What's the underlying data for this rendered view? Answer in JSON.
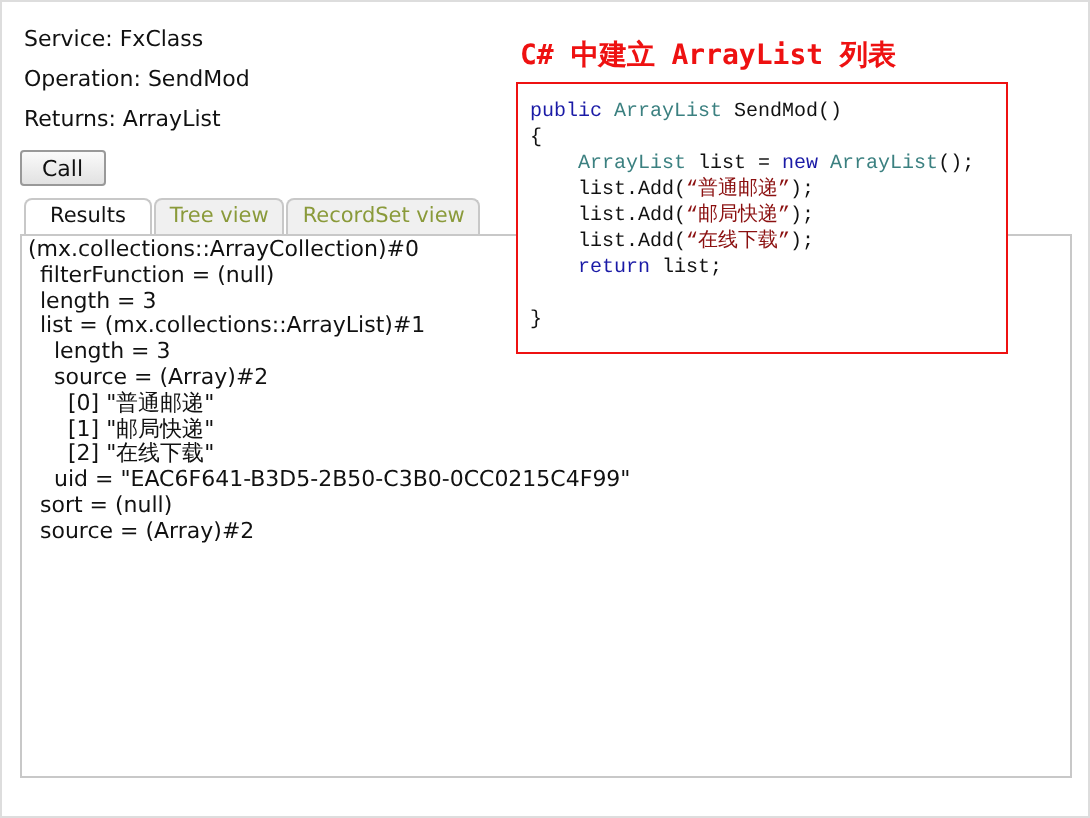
{
  "info": [
    {
      "label": "Service: FxClass"
    },
    {
      "label": "Operation: SendMod"
    },
    {
      "label": "Returns: ArrayList"
    }
  ],
  "call_button": {
    "label": "Call"
  },
  "tabs": [
    {
      "label": "Results",
      "selected": true
    },
    {
      "label": "Tree view",
      "selected": false
    },
    {
      "label": "RecordSet view",
      "selected": false
    }
  ],
  "results": [
    {
      "text": "(mx.collections::ArrayCollection)#0",
      "children": [
        {
          "text": "filterFunction = (null)"
        },
        {
          "text": "length = 3"
        },
        {
          "text": "list = (mx.collections::ArrayList)#1",
          "children": [
            {
              "text": "length = 3"
            },
            {
              "text": "source = (Array)#2",
              "children": [
                {
                  "text": "[0] \"普通邮递\""
                },
                {
                  "text": "[1] \"邮局快递\""
                },
                {
                  "text": "[2] \"在线下载\""
                }
              ]
            },
            {
              "text": "uid = \"EAC6F641-B3D5-2B50-C3B0-0CC0215C4F99\""
            }
          ]
        },
        {
          "text": "sort = (null)"
        },
        {
          "text": "source = (Array)#2"
        }
      ]
    }
  ],
  "annotation": {
    "title": "C# 中建立 ArrayList 列表",
    "code": [
      {
        "kind": "code",
        "tokens": [
          {
            "kind": "keyword",
            "text": "public "
          },
          {
            "kind": "type",
            "text": "ArrayList"
          },
          {
            "kind": "plain",
            "text": " SendMod()"
          }
        ]
      },
      {
        "kind": "code",
        "tokens": [
          {
            "kind": "plain",
            "text": "{"
          }
        ]
      },
      {
        "kind": "code",
        "tokens": [
          {
            "kind": "type",
            "text": "    ArrayList"
          },
          {
            "kind": "plain",
            "text": " list = "
          },
          {
            "kind": "keyword",
            "text": "new "
          },
          {
            "kind": "type",
            "text": "ArrayList"
          },
          {
            "kind": "plain",
            "text": "();"
          }
        ]
      },
      {
        "kind": "code",
        "tokens": [
          {
            "kind": "plain",
            "text": "    list.Add("
          },
          {
            "kind": "string",
            "text": "“普通邮递”"
          },
          {
            "kind": "plain",
            "text": ");"
          }
        ]
      },
      {
        "kind": "code",
        "tokens": [
          {
            "kind": "plain",
            "text": "    list.Add("
          },
          {
            "kind": "string",
            "text": "“邮局快递”"
          },
          {
            "kind": "plain",
            "text": ");"
          }
        ]
      },
      {
        "kind": "code",
        "tokens": [
          {
            "kind": "plain",
            "text": "    list.Add("
          },
          {
            "kind": "string",
            "text": "“在线下载”"
          },
          {
            "kind": "plain",
            "text": ");"
          }
        ]
      },
      {
        "kind": "code",
        "tokens": [
          {
            "kind": "keyword",
            "text": "    return"
          },
          {
            "kind": "plain",
            "text": " list;"
          }
        ]
      },
      {
        "kind": "blank"
      },
      {
        "kind": "code",
        "tokens": [
          {
            "kind": "plain",
            "text": "}"
          }
        ]
      }
    ]
  }
}
